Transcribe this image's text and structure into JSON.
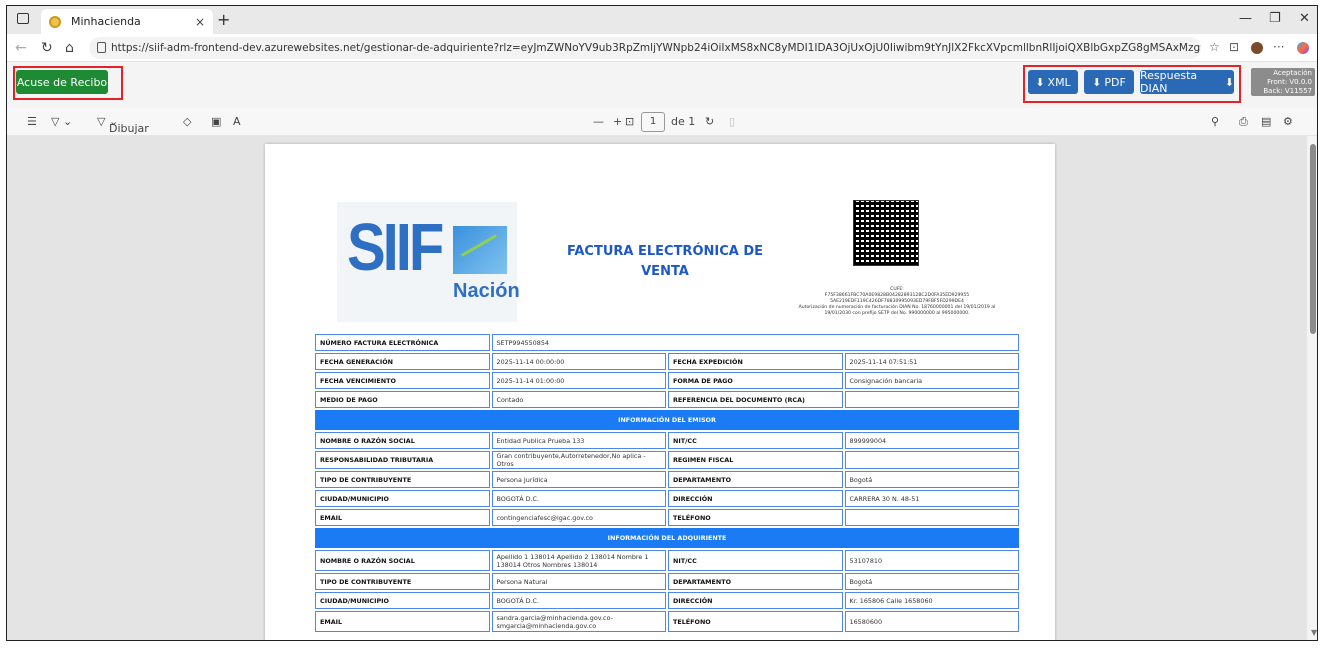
{
  "browser": {
    "tab_title": "Minhacienda",
    "tab_close": "×",
    "new_tab": "+",
    "url": "https://siif-adm-frontend-dev.azurewebsites.net/gestionar-de-adquiriente?rlz=eyJmZWNoYV9ub3RpZmljYWNpb24iOiIxMS8xNC8yMDI1IDA3OjUxOjU0Iiwibm9tYnJlX2FkcXVpcmllbnRlIjoiQXBlbGxpZG8gMSAxMzgwMTQgQXBlbGxpZG..."
  },
  "app_toolbar": {
    "acuse_label": "Acuse de Recibo",
    "xml_label": "XML",
    "pdf_label": "PDF",
    "dian_label": "Respuesta DIAN",
    "version_env": "Aceptación",
    "version_front": "Front: V0.0.0",
    "version_back": "Back: V11557"
  },
  "pdf_toolbar": {
    "draw_label": "Dibujar",
    "page_current": "1",
    "page_total": "de 1"
  },
  "invoice": {
    "title_line1": "FACTURA ELECTRÓNICA DE",
    "title_line2": "VENTA",
    "logo_text": "SIIF",
    "logo_sub": "Nación",
    "cufe_label": "CUFE:",
    "cufe_value": "F75F38661FBC70A0E9828B0428289312BC2D0FA35ED929955 5AE219EDF119C426DF78830995093ED79FBF5FD299DE4",
    "authorization": "Autorización de numeración de facturación DIAN No. 18760000001 del 19/01/2019 al 19/01/2030 con prefijo SETP del No. 990000000 al 995000000.",
    "rows_top": [
      {
        "l1": "NÚMERO FACTURA ELECTRÓNICA",
        "v1": "SETP994550854",
        "l2": "",
        "v2": ""
      },
      {
        "l1": "FECHA GENERACIÓN",
        "v1": "2025-11-14 00:00:00",
        "l2": "FECHA EXPEDICIÓN",
        "v2": "2025-11-14 07:51:51"
      },
      {
        "l1": "FECHA VENCIMIENTO",
        "v1": "2025-11-14 01:00:00",
        "l2": "FORMA DE PAGO",
        "v2": "Consignación bancaria"
      },
      {
        "l1": "MEDIO DE PAGO",
        "v1": "Contado",
        "l2": "REFERENCIA DEL DOCUMENTO (RCA)",
        "v2": ""
      }
    ],
    "section_emisor": "INFORMACIÓN DEL EMISOR",
    "rows_emisor": [
      {
        "l1": "NOMBRE O RAZÓN SOCIAL",
        "v1": "Entidad Publica Prueba 133",
        "l2": "NIT/CC",
        "v2": "899999004"
      },
      {
        "l1": "RESPONSABILIDAD TRIBUTARIA",
        "v1": "Gran contribuyente,Autorretenedor,No aplica - Otros",
        "l2": "REGIMEN FISCAL",
        "v2": ""
      },
      {
        "l1": "TIPO DE CONTRIBUYENTE",
        "v1": "Persona Jurídica",
        "l2": "DEPARTAMENTO",
        "v2": "Bogotá"
      },
      {
        "l1": "CIUDAD/MUNICIPIO",
        "v1": "BOGOTÁ D.C.",
        "l2": "DIRECCIÓN",
        "v2": "CARRERA 30 N. 48-51"
      },
      {
        "l1": "EMAIL",
        "v1": "contingenciafesc@igac.gov.co",
        "l2": "TELÉFONO",
        "v2": ""
      }
    ],
    "section_adquiriente": "INFORMACIÓN DEL ADQUIRIENTE",
    "rows_adquiriente": [
      {
        "l1": "NOMBRE O RAZÓN SOCIAL",
        "v1": "Apellido 1 138014 Apellido 2 138014 Nombre 1 138014 Otros Nombres 138014",
        "l2": "NIT/CC",
        "v2": "53107810"
      },
      {
        "l1": "TIPO DE CONTRIBUYENTE",
        "v1": "Persona Natural",
        "l2": "DEPARTAMENTO",
        "v2": "Bogotá"
      },
      {
        "l1": "CIUDAD/MUNICIPIO",
        "v1": "BOGOTÁ D.C.",
        "l2": "DIRECCIÓN",
        "v2": "Kr. 165806 Calle 1658060"
      },
      {
        "l1": "EMAIL",
        "v1": "sandra.garcia@minhacienda.gov.co-smgarcia@minhacienda.gov.co",
        "l2": "TELÉFONO",
        "v2": "16580600"
      }
    ]
  }
}
